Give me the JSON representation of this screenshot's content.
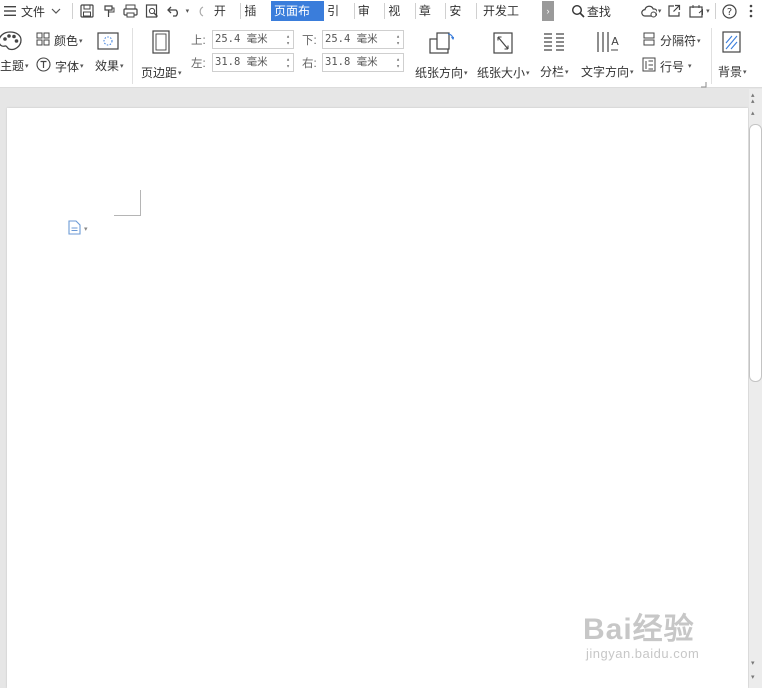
{
  "menubar": {
    "file_label": "文件",
    "tabs": [
      "开始",
      "插入",
      "页面布局",
      "引用",
      "审阅",
      "视图",
      "章节",
      "安全",
      "开发工具"
    ],
    "active_tab": "页面布局",
    "search_label": "查找",
    "more_glyph": "›",
    "help_glyph": "?"
  },
  "ribbon": {
    "theme_label": "主题",
    "color_label": "颜色",
    "font_label": "字体",
    "effect_label": "效果",
    "margins_label": "页边距",
    "margin_top_label": "上:",
    "margin_bottom_label": "下:",
    "margin_left_label": "左:",
    "margin_right_label": "右:",
    "margin_top_value": "25.4 毫米",
    "margin_bottom_value": "25.4 毫米",
    "margin_left_value": "31.8 毫米",
    "margin_right_value": "31.8 毫米",
    "orientation_label": "纸张方向",
    "size_label": "纸张大小",
    "columns_label": "分栏",
    "text_direction_label": "文字方向",
    "separator_label": "分隔符",
    "line_number_label": "行号",
    "background_label": "背景"
  },
  "watermark": {
    "brand": "Bai经验",
    "url": "jingyan.baidu.com"
  },
  "colors": {
    "accent": "#3a7ddb",
    "page": "#ffffff",
    "canvas": "#e6e6e6"
  }
}
